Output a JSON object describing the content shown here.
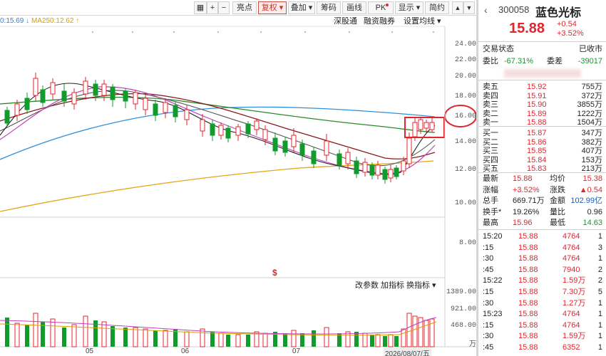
{
  "toolbar": {
    "buttons": [
      "+",
      "−",
      "亮点",
      "复权 ▾",
      "叠加 ▾",
      "筹码",
      "画线",
      "PK",
      "显示 ▾",
      "简约"
    ],
    "icons": [
      "grid-icon",
      "up-icon",
      "down-icon"
    ]
  },
  "indicators": {
    "ma_line": "0:15.69 ↓ MA250:12.62 ↑",
    "ma_a": "0:15.69 ↓",
    "ma_b": "MA250:12.62 ↑"
  },
  "links": {
    "shenguton": "深股通",
    "rongzi": "融资融券",
    "settings": "设置均线 ▾"
  },
  "price_axis": [
    "24.00",
    "22.00",
    "20.00",
    "18.00",
    "16.00",
    "14.00",
    "12.00",
    "10.00",
    "8.00"
  ],
  "volume_links": [
    "改参数",
    "加指标",
    "换指标 ▾"
  ],
  "volume_axis": [
    "1389.00",
    "921.00",
    "468.00",
    "万"
  ],
  "x_axis": [
    "05",
    "06",
    "07",
    "2026/08/07/五"
  ],
  "marker": "$",
  "quote": {
    "code": "300058",
    "name": "蓝色光标",
    "price": "15.88",
    "change": "+0.54",
    "change_pct": "+3.52%",
    "status_label": "交易状态",
    "status_value": "已收市",
    "wb_label": "委比",
    "wb_value": "-67.31%",
    "wc_label": "委差",
    "wc_value": "-39017"
  },
  "sell": [
    {
      "label": "卖五",
      "price": "15.92",
      "vol": "755万"
    },
    {
      "label": "卖四",
      "price": "15.91",
      "vol": "372万"
    },
    {
      "label": "卖三",
      "price": "15.90",
      "vol": "3855万"
    },
    {
      "label": "卖二",
      "price": "15.89",
      "vol": "1222万"
    },
    {
      "label": "卖一",
      "price": "15.88",
      "vol": "1504万"
    }
  ],
  "buy": [
    {
      "label": "买一",
      "price": "15.87",
      "vol": "347万"
    },
    {
      "label": "买二",
      "price": "15.86",
      "vol": "382万"
    },
    {
      "label": "买三",
      "price": "15.85",
      "vol": "407万"
    },
    {
      "label": "买四",
      "price": "15.84",
      "vol": "153万"
    },
    {
      "label": "买五",
      "price": "15.83",
      "vol": "213万"
    }
  ],
  "stats": [
    {
      "l1": "最新",
      "v1": "15.88",
      "c1": "red",
      "l2": "均价",
      "v2": "15.38",
      "c2": "red"
    },
    {
      "l1": "涨幅",
      "v1": "+3.52%",
      "c1": "red",
      "l2": "涨跌",
      "v2": "▲0.54",
      "c2": "red"
    },
    {
      "l1": "总手",
      "v1": "669.71万",
      "c1": "dark",
      "l2": "金额",
      "v2": "102.99亿",
      "c2": "blue"
    },
    {
      "l1": "换手*",
      "v1": "19.26%",
      "c1": "dark",
      "l2": "量比",
      "v2": "0.96",
      "c2": "dark"
    },
    {
      "l1": "最高",
      "v1": "15.96",
      "c1": "red",
      "l2": "最低",
      "v2": "14.63",
      "c2": "green"
    }
  ],
  "ticks": [
    {
      "time": "15:20",
      "price": "15.88",
      "vol": "4764",
      "n": "1"
    },
    {
      "time": ":15",
      "price": "15.88",
      "vol": "4764",
      "n": "3"
    },
    {
      "time": ":30",
      "price": "15.88",
      "vol": "4764",
      "n": "1"
    },
    {
      "time": ":45",
      "price": "15.88",
      "vol": "7940",
      "n": "2"
    },
    {
      "time": "15:22",
      "price": "15.88",
      "vol": "1.59万",
      "n": "2"
    },
    {
      "time": ":15",
      "price": "15.88",
      "vol": "7.30万",
      "n": "5"
    },
    {
      "time": ":30",
      "price": "15.88",
      "vol": "1.27万",
      "n": "1"
    },
    {
      "time": "15:23",
      "price": "15.88",
      "vol": "4764",
      "n": "1"
    },
    {
      "time": ":15",
      "price": "15.88",
      "vol": "4764",
      "n": "1"
    },
    {
      "time": ":30",
      "price": "15.88",
      "vol": "1.59万",
      "n": "1"
    },
    {
      "time": ":45",
      "price": "15.88",
      "vol": "6352",
      "n": "1"
    }
  ],
  "colors": {
    "up": "#e0262d",
    "down": "#109b2b",
    "highlight": "#e0262d"
  }
}
